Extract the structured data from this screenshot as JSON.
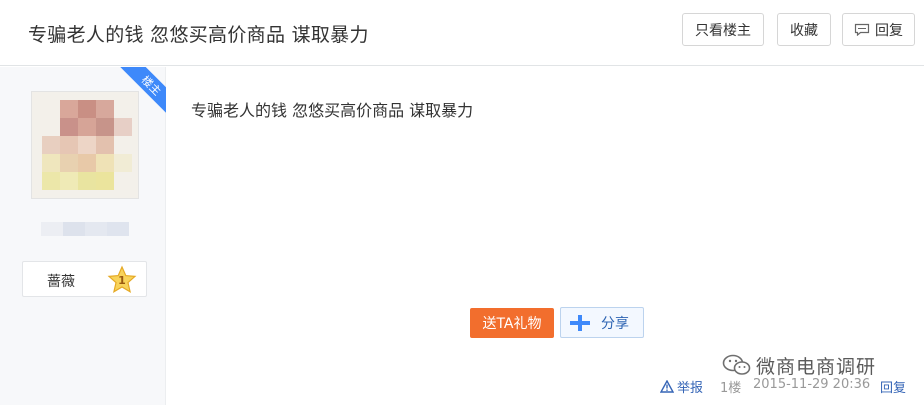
{
  "header": {
    "title": "专骗老人的钱 忽悠买高价商品 谋取暴力",
    "owner_only_label": "只看楼主",
    "favorite_label": "收藏",
    "reply_label": "回复"
  },
  "author": {
    "ribbon_label": "楼主",
    "badge_label": "蔷薇",
    "badge_level": "1"
  },
  "post": {
    "content": "专骗老人的钱 忽悠买高价商品 谋取暴力",
    "gift_label": "送TA礼物",
    "share_label": "分享"
  },
  "watermark": {
    "text": "微商电商调研"
  },
  "footer": {
    "report_label": "举报",
    "floor": "1楼",
    "timestamp": "2015-11-29 20:36",
    "reply_label": "回复"
  },
  "colors": {
    "accent_blue": "#3e89fa",
    "gift_orange": "#f26e2d",
    "link_blue": "#3565b6"
  }
}
